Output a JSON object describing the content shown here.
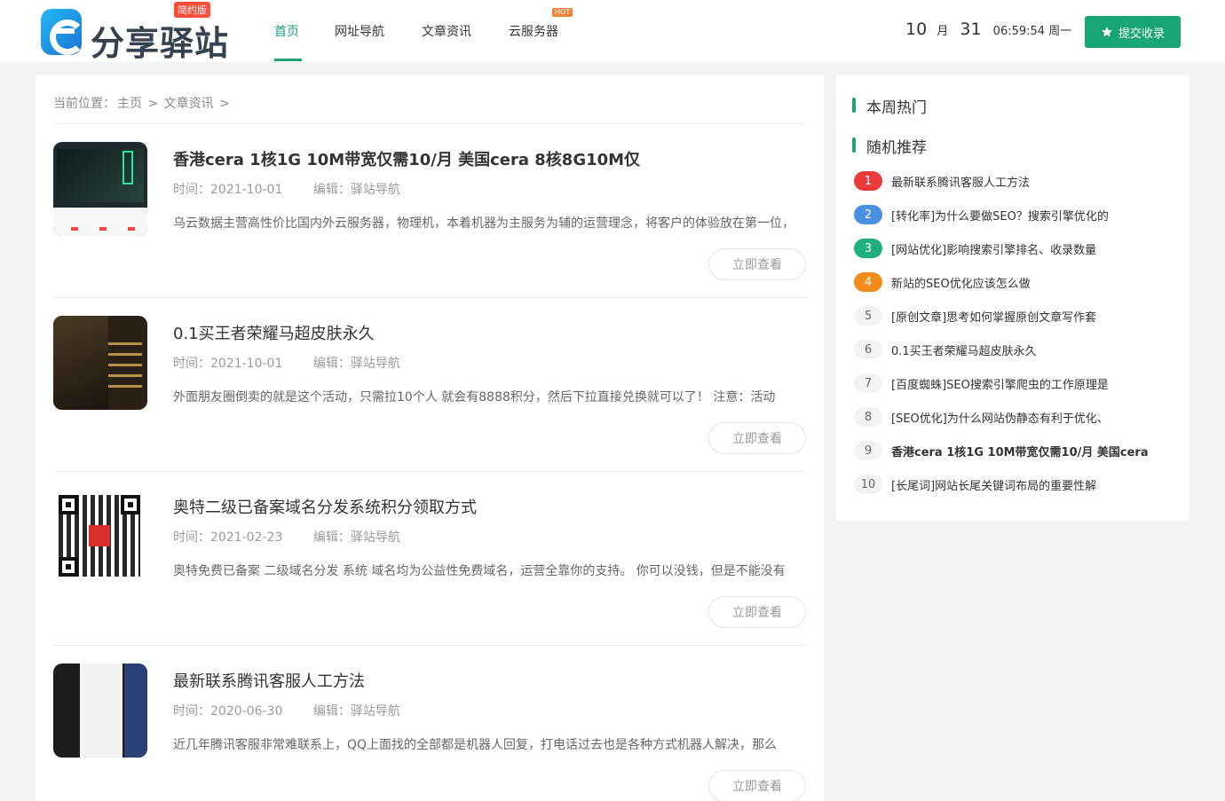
{
  "header": {
    "logo_text": "分享驿站",
    "logo_badge": "简约版",
    "nav": [
      {
        "label": "首页",
        "active": true
      },
      {
        "label": "网址导航"
      },
      {
        "label": "文章资讯"
      },
      {
        "label": "云服务器",
        "badge": "HOT"
      }
    ],
    "clock": {
      "month": "10",
      "month_unit": "月",
      "day": "31",
      "time": "06:59:54 周一"
    },
    "submit_label": "提交收录"
  },
  "breadcrumb": {
    "prefix": "当前位置：",
    "home": "主页",
    "sep1": " > ",
    "current": "文章资讯",
    "sep2": " >"
  },
  "articles": [
    {
      "title": "香港cera 1核1G 10M带宽仅需10/月 美国cera 8核8G10M仅",
      "time_label": "时间：",
      "date": "2021-10-01",
      "editor_label": "编辑：",
      "editor": "驿站导航",
      "excerpt": "乌云数据主营高性价比国内外云服务器，物理机，本着机器为主服务为辅的运营理念，将客户的体验放在第一位，",
      "more": "立即查看"
    },
    {
      "title": "0.1买王者荣耀马超皮肤永久",
      "time_label": "时间：",
      "date": "2021-10-01",
      "editor_label": "编辑：",
      "editor": "驿站导航",
      "excerpt": "外面朋友圈倒卖的就是这个活动，只需拉10个人 就会有8888积分，然后下拉直接兑换就可以了！ 注意：活动",
      "more": "立即查看"
    },
    {
      "title": "奥特二级已备案域名分发系统积分领取方式",
      "time_label": "时间：",
      "date": "2021-02-23",
      "editor_label": "编辑：",
      "editor": "驿站导航",
      "excerpt": "奥特免费已备案 二级域名分发 系统 域名均为公益性免费域名，运营全靠你的支持。 你可以没钱，但是不能没有",
      "more": "立即查看"
    },
    {
      "title": "最新联系腾讯客服人工方法",
      "time_label": "时间：",
      "date": "2020-06-30",
      "editor_label": "编辑：",
      "editor": "驿站导航",
      "excerpt": "近几年腾讯客服非常难联系上，QQ上面找的全部都是机器人回复，打电话过去也是各种方式机器人解决，那么",
      "more": "立即查看"
    }
  ],
  "sidebar": {
    "hot_title": "本周热门",
    "random_title": "随机推荐",
    "items": [
      {
        "num": "1",
        "text": "最新联系腾讯客服人工方法"
      },
      {
        "num": "2",
        "text": "[转化率]为什么要做SEO？搜索引擎优化的"
      },
      {
        "num": "3",
        "text": "[网站优化]影响搜索引擎排名、收录数量"
      },
      {
        "num": "4",
        "text": "新站的SEO优化应该怎么做"
      },
      {
        "num": "5",
        "text": "[原创文章]思考如何掌握原创文章写作套"
      },
      {
        "num": "6",
        "text": "0.1买王者荣耀马超皮肤永久"
      },
      {
        "num": "7",
        "text": "[百度蜘蛛]SEO搜索引擎爬虫的工作原理是"
      },
      {
        "num": "8",
        "text": "[SEO优化]为什么网站伪静态有利于优化、"
      },
      {
        "num": "9",
        "text": "香港cera 1核1G 10M带宽仅需10/月 美国cera"
      },
      {
        "num": "10",
        "text": "[长尾词]网站长尾关键词布局的重要性解"
      }
    ]
  },
  "colors": {
    "accent": "#1aa574",
    "rank1": "#ec3a3a",
    "rank2": "#4a90e2",
    "rank3": "#20b07e",
    "rank4": "#f08a19"
  },
  "icons": {
    "submit": "star-icon"
  }
}
